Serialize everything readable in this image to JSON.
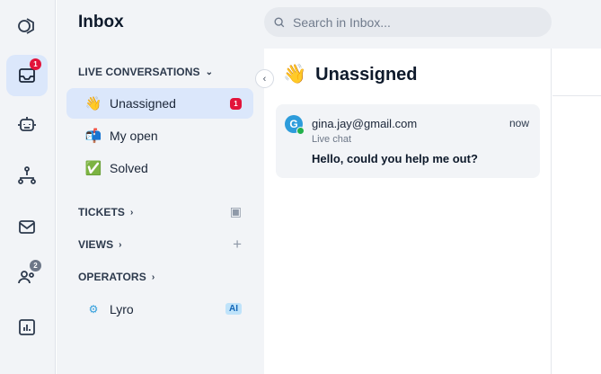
{
  "rail": {
    "inbox_badge": "1",
    "contacts_badge": "2"
  },
  "inbox": {
    "title": "Inbox",
    "live_conversations": {
      "header": "LIVE CONVERSATIONS",
      "items": [
        {
          "emoji": "👋",
          "label": "Unassigned",
          "badge": "1"
        },
        {
          "emoji": "📬",
          "label": "My open"
        },
        {
          "emoji": "✅",
          "label": "Solved"
        }
      ]
    },
    "tickets": {
      "header": "TICKETS"
    },
    "views": {
      "header": "VIEWS"
    },
    "operators": {
      "header": "OPERATORS",
      "items": [
        {
          "label": "Lyro",
          "tag": "AI"
        }
      ]
    }
  },
  "search": {
    "placeholder": "Search in Inbox..."
  },
  "panel": {
    "emoji": "👋",
    "title": "Unassigned",
    "conversations": [
      {
        "avatar_letter": "G",
        "email": "gina.jay@gmail.com",
        "time": "now",
        "channel": "Live chat",
        "message": "Hello, could you help me out?"
      }
    ]
  },
  "colors": {
    "accent": "#dbe7fb",
    "badge": "#e2133a",
    "sidebar_bg": "#f2f4f7"
  }
}
